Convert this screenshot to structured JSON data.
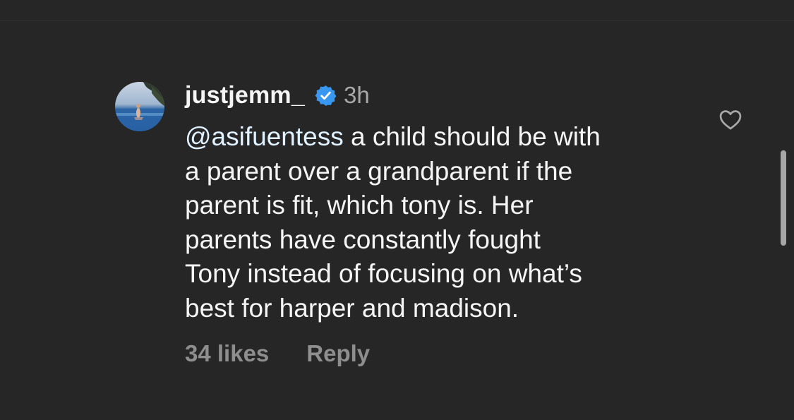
{
  "comment": {
    "username": "justjemm_",
    "verified": true,
    "timestamp": "3h",
    "mention": "@asifuentess",
    "text_line1_rest": " a child should be with",
    "text_lines": [
      "a parent over a grandparent if the",
      "parent is fit, which tony is. Her",
      "parents have constantly fought",
      "Tony instead of focusing on what’s",
      "best for harper and madison."
    ],
    "likes_label": "34 likes",
    "reply_label": "Reply"
  },
  "icons": {
    "avatar": "profile-photo-avatar",
    "verified": "verified-badge-icon",
    "like": "heart-outline-icon"
  },
  "colors": {
    "background": "#262626",
    "primary_text": "#f5f5f5",
    "secondary_text": "#a8a8a8",
    "action_text": "#8e8e8e",
    "mention": "#e0f1ff",
    "verified_blue": "#3897f0"
  }
}
